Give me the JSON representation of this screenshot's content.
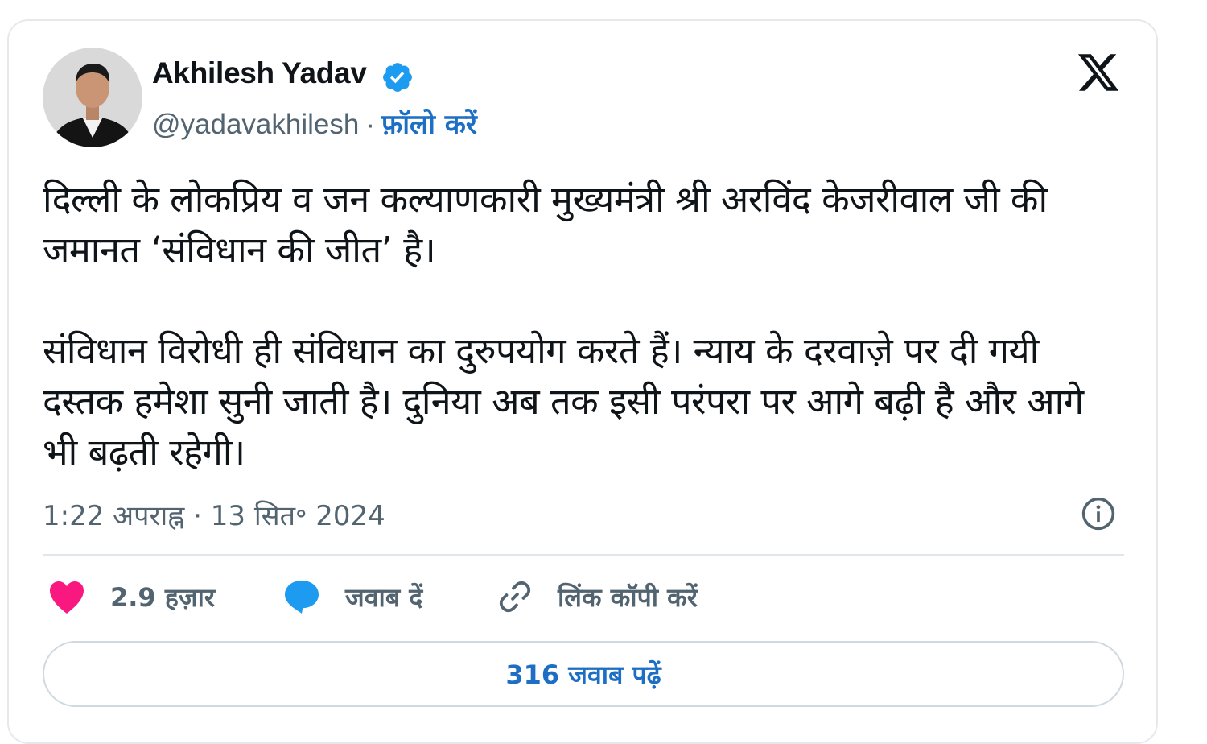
{
  "author": {
    "display_name": "Akhilesh Yadav",
    "handle": "@yadavakhilesh",
    "separator": "·",
    "follow_label": "फ़ॉलो करें",
    "verified_color": "#1d9bf0"
  },
  "tweet": {
    "paragraphs": [
      "दिल्ली के लोकप्रिय व जन कल्याणकारी मुख्यमंत्री श्री अरविंद केजरीवाल जी की जमानत ‘संविधान की जीत’ है।",
      "संविधान विरोधी ही संविधान का दुरुपयोग करते हैं। न्याय के दरवाज़े पर दी गयी दस्तक हमेशा सुनी जाती है। दुनिया अब तक इसी परंपरा पर आगे बढ़ी है और आगे भी बढ़ती रहेगी।"
    ],
    "time": "1:22 अपराह्न",
    "separator": "·",
    "date": "13 सित॰ 2024"
  },
  "actions": {
    "like_count": "2.9 हज़ार",
    "reply_label": "जवाब दें",
    "copy_link_label": "लिंक कॉपी करें"
  },
  "read_replies_label": "316 जवाब पढ़ें",
  "icons": {
    "verified": "verified-badge-icon",
    "x_logo": "x-logo-icon",
    "info": "info-icon",
    "like": "heart-icon",
    "reply": "speech-bubble-icon",
    "copy_link": "link-icon"
  },
  "colors": {
    "text_primary": "#0f1419",
    "text_secondary": "#536471",
    "link_blue": "#1d6fc4",
    "heart": "#f91880",
    "reply_bubble": "#1d9bf0"
  }
}
